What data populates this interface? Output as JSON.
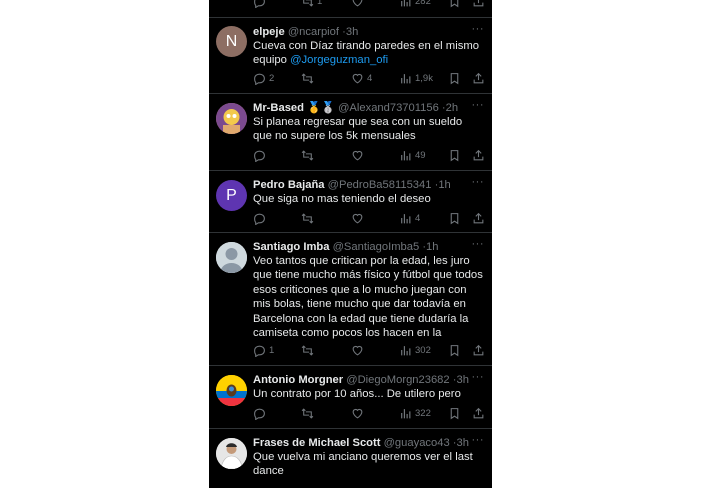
{
  "tweets": [
    {
      "name": "elpeje",
      "badges": "",
      "handle": "@ncarpiof",
      "time": "3h",
      "text": "Cueva con Díaz tirando paredes en el mismo equipo ",
      "mention": "@Jorgeguzman_ofi",
      "replies": "2",
      "retweets": "",
      "likes": "4",
      "views": "1,9k",
      "avatar_letter": "N",
      "avatar_color": "#8d6e63"
    },
    {
      "name": "Mr-Based",
      "badges": "🥇🥈",
      "handle": "@Alexand73701156",
      "time": "2h",
      "text": "Si planea regresar que sea con un sueldo que no supere los 5k mensuales",
      "replies": "",
      "retweets": "",
      "likes": "",
      "views": "49",
      "avatar_letter": "",
      "avatar_color": "#c58b6a"
    },
    {
      "name": "Pedro Bajaña",
      "badges": "",
      "handle": "@PedroBa58115341",
      "time": "1h",
      "text": "Que siga no mas teniendo el deseo",
      "replies": "",
      "retweets": "",
      "likes": "",
      "views": "4",
      "avatar_letter": "P",
      "avatar_color": "#5e35b1"
    },
    {
      "name": "Santiago Imba",
      "badges": "",
      "handle": "@SantiagoImba5",
      "time": "1h",
      "text": "Veo tantos que critican por la edad, les juro que tiene mucho más físico y fútbol que todos esos criticones que a lo mucho juegan con mis bolas, tiene mucho que dar todavía en Barcelona con la edad que tiene dudaría la camiseta como pocos los hacen en la cancha, desde que el se",
      "replies": "1",
      "retweets": "",
      "likes": "",
      "views": "302",
      "avatar_letter": "",
      "avatar_color": "#cfd9de"
    },
    {
      "name": "Antonio Morgner",
      "badges": "",
      "handle": "@DiegoMorgn23682",
      "time": "3h",
      "text": "Un contrato por 10 años... De utilero pero",
      "replies": "",
      "retweets": "",
      "likes": "",
      "views": "322",
      "avatar_letter": "",
      "avatar_color": "#ffd100"
    },
    {
      "name": "Frases de Michael Scott",
      "badges": "",
      "handle": "@guayaco43",
      "time": "3h",
      "text": "Que vuelva mi anciano queremos ver el last dance",
      "replies": "",
      "retweets": "",
      "likes": "",
      "views": "",
      "avatar_letter": "",
      "avatar_color": "#d9d9d9"
    }
  ],
  "partial_top": {
    "retweets": "1",
    "views": "282"
  },
  "more_label": "···",
  "dot": "·",
  "colors": {
    "background": "#000000",
    "text": "#e7e9ea",
    "muted": "#71767b",
    "link": "#1d9bf0",
    "divider": "#2f3336"
  }
}
